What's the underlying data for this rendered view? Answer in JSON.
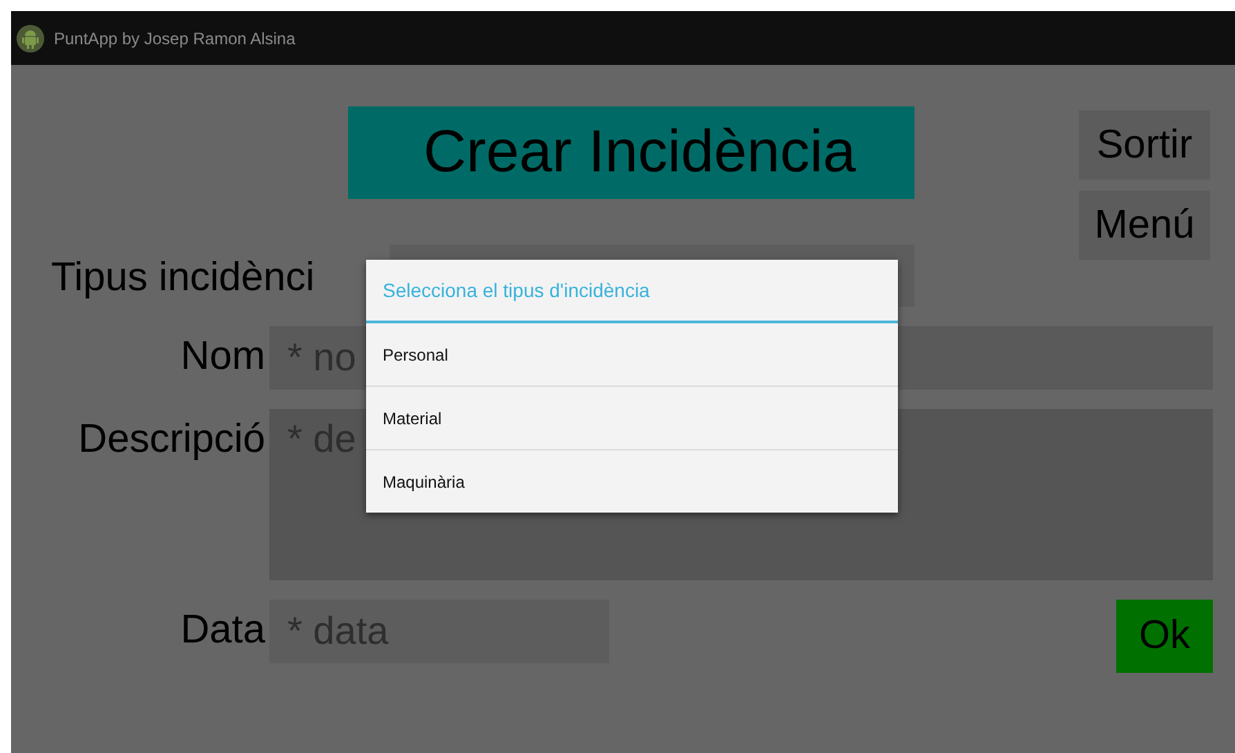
{
  "status_bar": {
    "title": "PuntApp by Josep Ramon Alsina"
  },
  "header": {
    "title": "Crear Incidència"
  },
  "buttons": [
    {
      "label": "Sortir"
    },
    {
      "label": "Menú"
    }
  ],
  "form": {
    "fields": [
      {
        "kind": "select",
        "label": "Tipus incidènci"
      },
      {
        "kind": "text",
        "label": "Nom",
        "placeholder": "* no"
      },
      {
        "kind": "multiline",
        "label": "Descripció",
        "placeholder": "* de"
      },
      {
        "kind": "date",
        "label": "Data",
        "placeholder": "* data"
      }
    ],
    "submit": "Ok"
  },
  "dialog": {
    "title": "Selecciona el tipus d'incidència",
    "options": [
      {
        "label": "Personal"
      },
      {
        "label": "Material"
      },
      {
        "label": "Maquinària"
      }
    ]
  }
}
